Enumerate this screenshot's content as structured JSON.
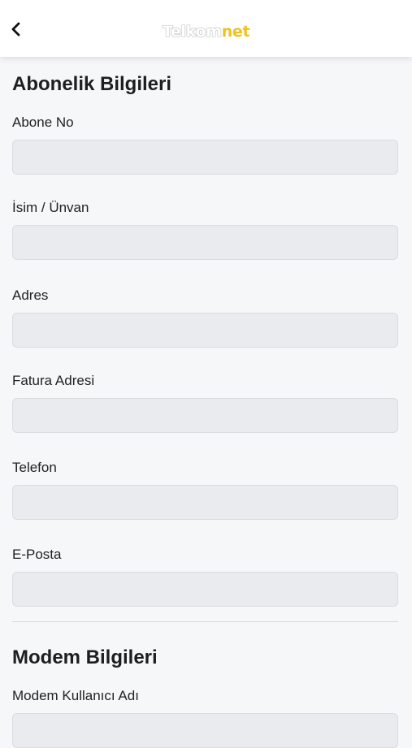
{
  "header": {
    "back_icon": "chevron-left-icon",
    "logo_part1": "Telkom",
    "logo_part2": "net",
    "accent_color": "#f2c21b"
  },
  "abonelik": {
    "title": "Abonelik Bilgileri",
    "fields": [
      {
        "label": "Abone No",
        "value": ""
      },
      {
        "label": "İsim / Ünvan",
        "value": ""
      },
      {
        "label": "Adres",
        "value": ""
      },
      {
        "label": "Fatura Adresi",
        "value": ""
      },
      {
        "label": "Telefon",
        "value": ""
      },
      {
        "label": "E-Posta",
        "value": ""
      }
    ]
  },
  "modem": {
    "title": "Modem Bilgileri",
    "fields": [
      {
        "label": "Modem Kullanıcı Adı",
        "value": ""
      }
    ]
  }
}
